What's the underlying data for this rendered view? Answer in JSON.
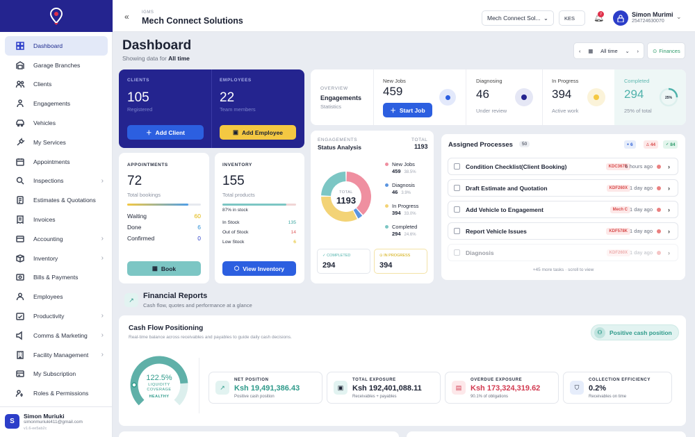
{
  "sidebar": {
    "items": [
      {
        "label": "Dashboard",
        "icon": "dashboard-icon",
        "chevron": false
      },
      {
        "label": "Garage Branches",
        "icon": "garage-icon",
        "chevron": false
      },
      {
        "label": "Clients",
        "icon": "clients-icon",
        "chevron": false
      },
      {
        "label": "Engagements",
        "icon": "engagements-icon",
        "chevron": false
      },
      {
        "label": "Vehicles",
        "icon": "vehicle-icon",
        "chevron": false
      },
      {
        "label": "My Services",
        "icon": "wrench-icon",
        "chevron": false
      },
      {
        "label": "Appointments",
        "icon": "calendar-icon",
        "chevron": false
      },
      {
        "label": "Inspections",
        "icon": "inspection-icon",
        "chevron": true
      },
      {
        "label": "Estimates & Quotations",
        "icon": "estimate-icon",
        "chevron": false
      },
      {
        "label": "Invoices",
        "icon": "invoice-icon",
        "chevron": false
      },
      {
        "label": "Accounting",
        "icon": "accounting-icon",
        "chevron": true
      },
      {
        "label": "Inventory",
        "icon": "inventory-icon",
        "chevron": true
      },
      {
        "label": "Bills & Payments",
        "icon": "bills-icon",
        "chevron": false
      },
      {
        "label": "Employees",
        "icon": "employees-icon",
        "chevron": false
      },
      {
        "label": "Productivity",
        "icon": "productivity-icon",
        "chevron": true
      },
      {
        "label": "Comms & Marketing",
        "icon": "comms-icon",
        "chevron": true
      },
      {
        "label": "Facility Management",
        "icon": "facility-icon",
        "chevron": true
      },
      {
        "label": "My Subscription",
        "icon": "subscription-icon",
        "chevron": false
      },
      {
        "label": "Roles & Permissions",
        "icon": "roles-icon",
        "chevron": false
      }
    ],
    "user": {
      "initial": "S",
      "name": "Simon Muriuki",
      "email": "simonmuriuki411@gmail.com",
      "version": "v1.6-ee5ab2c"
    }
  },
  "header": {
    "app_small": "IGMS",
    "company": "Mech Connect Solutions",
    "branch_select": "Mech Connect Sol...",
    "currency": "KES",
    "notif_count": "7",
    "user_name": "Simon Murimi",
    "user_phone": "254724630070"
  },
  "page": {
    "title": "Dashboard",
    "showing_prefix": "Showing data for",
    "showing_value": "All time",
    "range": "All time",
    "finances": "Finances"
  },
  "clients": {
    "label": "CLIENTS",
    "value": "105",
    "sub": "Registered",
    "button": "Add Client"
  },
  "employees": {
    "label": "EMPLOYEES",
    "value": "22",
    "sub": "Team members",
    "button": "Add Employee"
  },
  "overview": {
    "label": "OVERVIEW",
    "title": "Engagements",
    "sub": "Statistics",
    "new_jobs_label": "New Jobs",
    "new_jobs_value": "459",
    "start_job": "Start Job",
    "diagnosing_label": "Diagnosing",
    "diagnosing_value": "46",
    "diagnosing_sub": "Under review",
    "progress_label": "In Progress",
    "progress_value": "394",
    "progress_sub": "Active work",
    "completed_label": "Completed",
    "completed_value": "294",
    "completed_sub": "25% of total",
    "completed_pct": "25%",
    "completed_fraction": 0.25
  },
  "appointments": {
    "label": "APPOINTMENTS",
    "value": "72",
    "sub": "Total bookings",
    "rows": [
      {
        "k": "Waiting",
        "v": "60",
        "c": "#e0b400"
      },
      {
        "k": "Done",
        "v": "6",
        "c": "#2b8fd6"
      },
      {
        "k": "Confirmed",
        "v": "0",
        "c": "#2c3ec9"
      }
    ],
    "button": "Book",
    "bar_fill": 0.83
  },
  "inventory": {
    "label": "INVENTORY",
    "value": "155",
    "sub": "Total products",
    "pct_text": "87% in stock",
    "bar_fill": 0.87,
    "rows": [
      {
        "k": "In Stock",
        "v": "135",
        "c": "#3aa6a0"
      },
      {
        "k": "Out of Stock",
        "v": "14",
        "c": "#e06060"
      },
      {
        "k": "Low Stock",
        "v": "6",
        "c": "#e0b400"
      }
    ],
    "button": "View Inventory"
  },
  "status": {
    "label": "ENGAGEMENTS",
    "title": "Status Analysis",
    "total_label": "TOTAL",
    "total": "1193",
    "center_label": "TOTAL",
    "center_value": "1193",
    "legend": [
      {
        "name": "New Jobs",
        "value": "459",
        "pct": "38.5%",
        "color": "#ef8fa0"
      },
      {
        "name": "Diagnosis",
        "value": "46",
        "pct": "3.9%",
        "color": "#5b95e0"
      },
      {
        "name": "In Progress",
        "value": "394",
        "pct": "33.0%",
        "color": "#f3d376"
      },
      {
        "name": "Completed",
        "value": "294",
        "pct": "24.6%",
        "color": "#7cc6c4"
      }
    ],
    "completed_label": "COMPLETED",
    "completed_value": "294",
    "inprogress_label": "IN PROGRESS",
    "inprogress_value": "394"
  },
  "chart_data": {
    "type": "pie",
    "categories": [
      "New Jobs",
      "Diagnosis",
      "In Progress",
      "Completed"
    ],
    "values": [
      459,
      46,
      394,
      294
    ]
  },
  "processes": {
    "title": "Assigned Processes",
    "count": "50",
    "badges": [
      {
        "t": "6",
        "c": "#2c5fd6",
        "bg": "#e6edfb",
        "ic": "●"
      },
      {
        "t": "44",
        "c": "#d84b4b",
        "bg": "#fde8e8",
        "ic": "△"
      },
      {
        "t": "84",
        "c": "#2e9a6a",
        "bg": "#e2f5ec",
        "ic": "✓"
      }
    ],
    "items": [
      {
        "name": "Condition Checklist(Client Booking)",
        "tag": "KDC367B",
        "time": "6 hours ago"
      },
      {
        "name": "Draft Estimate and Quotation",
        "tag": "KDF260X",
        "time": "1 day ago"
      },
      {
        "name": "Add Vehicle to Engagement",
        "tag": "Mech C",
        "time": "1 day ago"
      },
      {
        "name": "Report Vehicle Issues",
        "tag": "KDF578K",
        "time": "1 day ago"
      },
      {
        "name": "Diagnosis",
        "tag": "KDF260X",
        "time": "1 day ago"
      }
    ],
    "more": "+45 more tasks · scroll to view"
  },
  "financial": {
    "title": "Financial Reports",
    "sub": "Cash flow, quotes and performance at a glance"
  },
  "cashflow": {
    "title": "Cash Flow Positioning",
    "sub": "Real-time balance across receivables and payables to guide daily cash decisions.",
    "badge": "Positive cash position",
    "gauge_value": "122.5%",
    "gauge_l1": "LIQUIDITY",
    "gauge_l2": "COVERAGE",
    "gauge_status": "HEALTHY",
    "gauge_fraction": 0.82,
    "metrics": [
      {
        "label": "NET POSITION",
        "value": "Ksh 19,491,386.43",
        "cap": "Positive cash position",
        "color": "#2e9a8a",
        "icon": "trend-icon",
        "ic": "↗",
        "bg": "#e2f3f1"
      },
      {
        "label": "TOTAL EXPOSURE",
        "value": "Ksh 192,401,088.11",
        "cap": "Receivables + payables",
        "color": "#1c2233",
        "icon": "exposure-icon",
        "ic": "▣",
        "bg": "#e2f3f1"
      },
      {
        "label": "OVERDUE EXPOSURE",
        "value": "Ksh 173,324,319.62",
        "cap": "90.1% of obligations",
        "color": "#d23a50",
        "icon": "overdue-icon",
        "ic": "▤",
        "bg": "#fde8ea"
      },
      {
        "label": "COLLECTION EFFICIENCY",
        "value": "0.2%",
        "cap": "Receivables on time",
        "color": "#1c2233",
        "icon": "shield-icon",
        "ic": "⛉",
        "bg": "#e6edfb"
      }
    ]
  }
}
